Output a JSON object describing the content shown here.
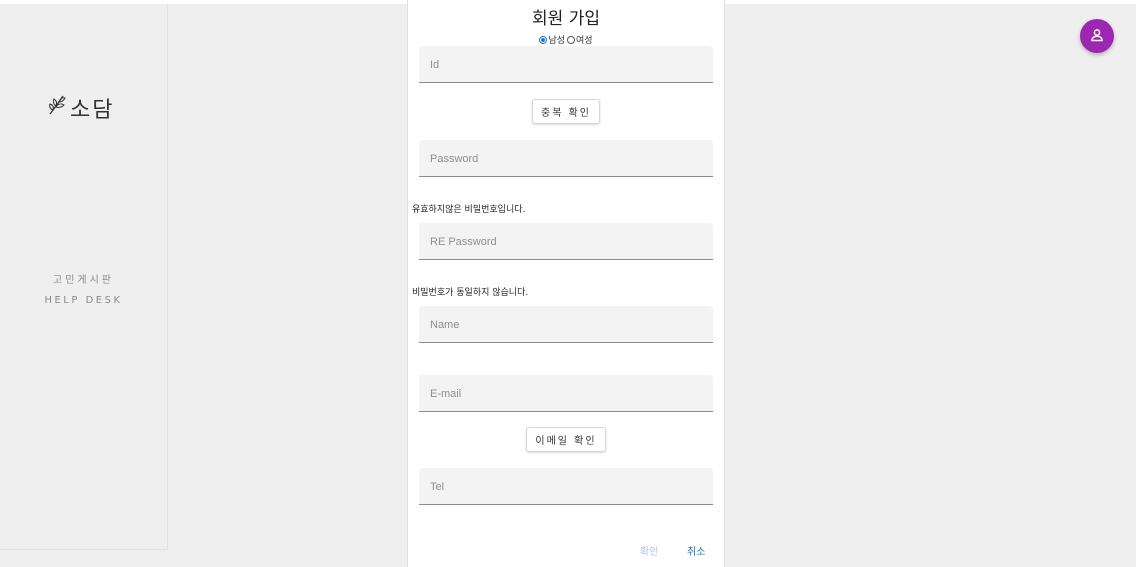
{
  "sidebar": {
    "logo_text": "소담",
    "links": [
      "고민게시판",
      "HELP DESK"
    ]
  },
  "header": {
    "avatar_icon": "user-icon",
    "accent": "#9c27b0"
  },
  "form": {
    "title": "회원 가입",
    "gender": {
      "options": [
        "남성",
        "여성"
      ],
      "selected": "남성"
    },
    "fields": {
      "id": {
        "placeholder": "Id",
        "value": ""
      },
      "password": {
        "placeholder": "Password",
        "value": ""
      },
      "re_password": {
        "placeholder": "RE Password",
        "value": ""
      },
      "name": {
        "placeholder": "Name",
        "value": ""
      },
      "email": {
        "placeholder": "E-mail",
        "value": ""
      },
      "tel": {
        "placeholder": "Tel",
        "value": ""
      }
    },
    "buttons": {
      "dup_check": "중복 확인",
      "email_check": "이메일 확인"
    },
    "messages": {
      "password_invalid": "유효하지않은 비밀번호입니다.",
      "password_mismatch": "비밀번호가 동일하지 않습니다."
    },
    "actions": {
      "confirm": "확인",
      "cancel": "취소"
    }
  }
}
